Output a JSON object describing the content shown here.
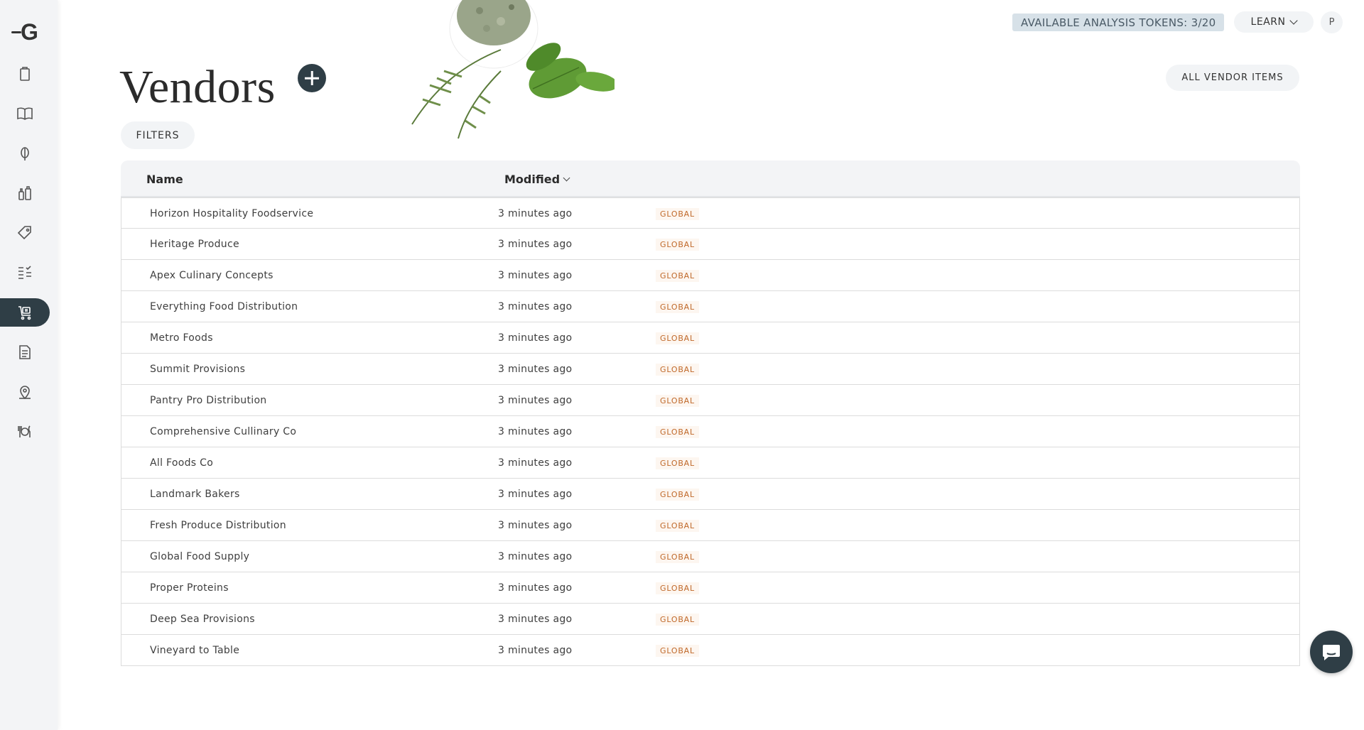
{
  "brand": {
    "logo_text": "G"
  },
  "sidebar": {
    "items": [
      {
        "icon": "clipboard-icon"
      },
      {
        "icon": "book-icon"
      },
      {
        "icon": "ingredient-icon"
      },
      {
        "icon": "bottles-icon"
      },
      {
        "icon": "tag-icon"
      },
      {
        "icon": "checklist-icon"
      },
      {
        "icon": "vendor-cart-icon",
        "active": true
      },
      {
        "icon": "document-icon"
      },
      {
        "icon": "location-icon"
      },
      {
        "icon": "dining-icon"
      }
    ]
  },
  "header": {
    "tokens_label": "AVAILABLE ANALYSIS TOKENS: 3/20",
    "learn_label": "LEARN",
    "avatar_initial": "P"
  },
  "page": {
    "title": "Vendors",
    "all_vendor_items_label": "ALL VENDOR ITEMS",
    "filters_label": "FILTERS"
  },
  "table": {
    "columns": {
      "name": "Name",
      "modified": "Modified"
    },
    "rows": [
      {
        "name": "Horizon Hospitality Foodservice",
        "modified": "3 minutes ago",
        "badge": "GLOBAL"
      },
      {
        "name": "Heritage Produce",
        "modified": "3 minutes ago",
        "badge": "GLOBAL"
      },
      {
        "name": "Apex Culinary Concepts",
        "modified": "3 minutes ago",
        "badge": "GLOBAL"
      },
      {
        "name": "Everything Food Distribution",
        "modified": "3 minutes ago",
        "badge": "GLOBAL"
      },
      {
        "name": "Metro Foods",
        "modified": "3 minutes ago",
        "badge": "GLOBAL"
      },
      {
        "name": "Summit Provisions",
        "modified": "3 minutes ago",
        "badge": "GLOBAL"
      },
      {
        "name": "Pantry Pro Distribution",
        "modified": "3 minutes ago",
        "badge": "GLOBAL"
      },
      {
        "name": "Comprehensive Cullinary Co",
        "modified": "3 minutes ago",
        "badge": "GLOBAL"
      },
      {
        "name": "All Foods Co",
        "modified": "3 minutes ago",
        "badge": "GLOBAL"
      },
      {
        "name": "Landmark Bakers",
        "modified": "3 minutes ago",
        "badge": "GLOBAL"
      },
      {
        "name": "Fresh Produce Distribution",
        "modified": "3 minutes ago",
        "badge": "GLOBAL"
      },
      {
        "name": "Global Food Supply",
        "modified": "3 minutes ago",
        "badge": "GLOBAL"
      },
      {
        "name": "Proper Proteins",
        "modified": "3 minutes ago",
        "badge": "GLOBAL"
      },
      {
        "name": "Deep Sea Provisions",
        "modified": "3 minutes ago",
        "badge": "GLOBAL"
      },
      {
        "name": "Vineyard to Table",
        "modified": "3 minutes ago",
        "badge": "GLOBAL"
      }
    ]
  },
  "colors": {
    "accent": "#2f3e46",
    "badge_text": "#c0692a",
    "sidebar_bg": "#f3f4f6"
  }
}
